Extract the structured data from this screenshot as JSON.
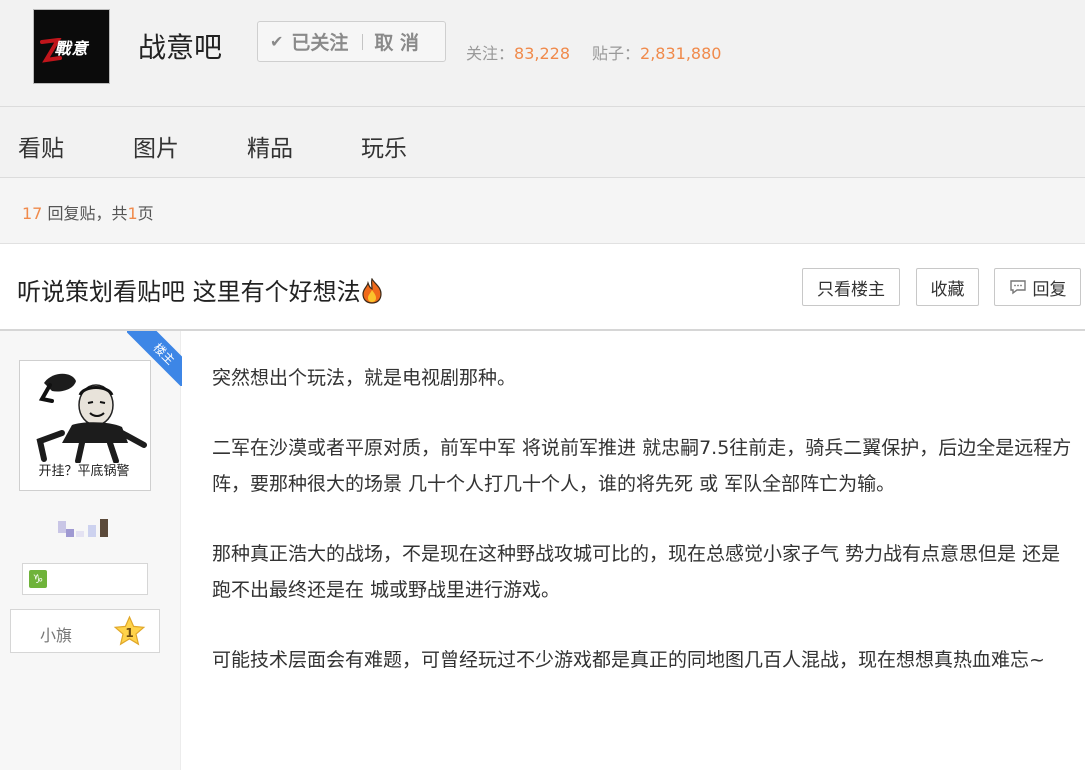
{
  "forum": {
    "name": "战意吧",
    "logo_text": "戰意",
    "follow_status": "已关注",
    "unfollow_label": "取 消",
    "stats_follow_label": "关注：",
    "stats_follow_value": "83,228",
    "stats_posts_label": "贴子：",
    "stats_posts_value": "2,831,880"
  },
  "nav": {
    "tabs": [
      "看贴",
      "图片",
      "精品",
      "玩乐"
    ]
  },
  "reply_info": {
    "count": "17",
    "mid_text": " 回复贴，共",
    "pages": "1",
    "suffix": "页"
  },
  "thread": {
    "title": "听说策划看贴吧 这里有个好想法",
    "buttons": {
      "only_op": "只看楼主",
      "favorite": "收藏",
      "reply": "回复"
    }
  },
  "author": {
    "badge": "楼主",
    "avatar_caption": "开挂？平底锅警",
    "level_icon": "♑",
    "rank_name": "小旗",
    "rank_level": "1"
  },
  "post": {
    "paragraphs": [
      "突然想出个玩法，就是电视剧那种。",
      "二军在沙漠或者平原对质，前军中军 将说前军推进 就忠嗣7.5往前走，骑兵二翼保护，后边全是远程方阵，要那种很大的场景 几十个人打几十个人，谁的将先死 或 军队全部阵亡为输。",
      "那种真正浩大的战场，不是现在这种野战攻城可比的，现在总感觉小家子气 势力战有点意思但是 还是跑不出最终还是在 城或野战里进行游戏。",
      "可能技术层面会有难题，可曾经玩过不少游戏都是真正的同地图几百人混战，现在想想真热血难忘~"
    ]
  },
  "colors": {
    "accent_orange": "#f08a4b",
    "badge_blue": "#3d86e6",
    "level_green": "#6fb33a"
  }
}
